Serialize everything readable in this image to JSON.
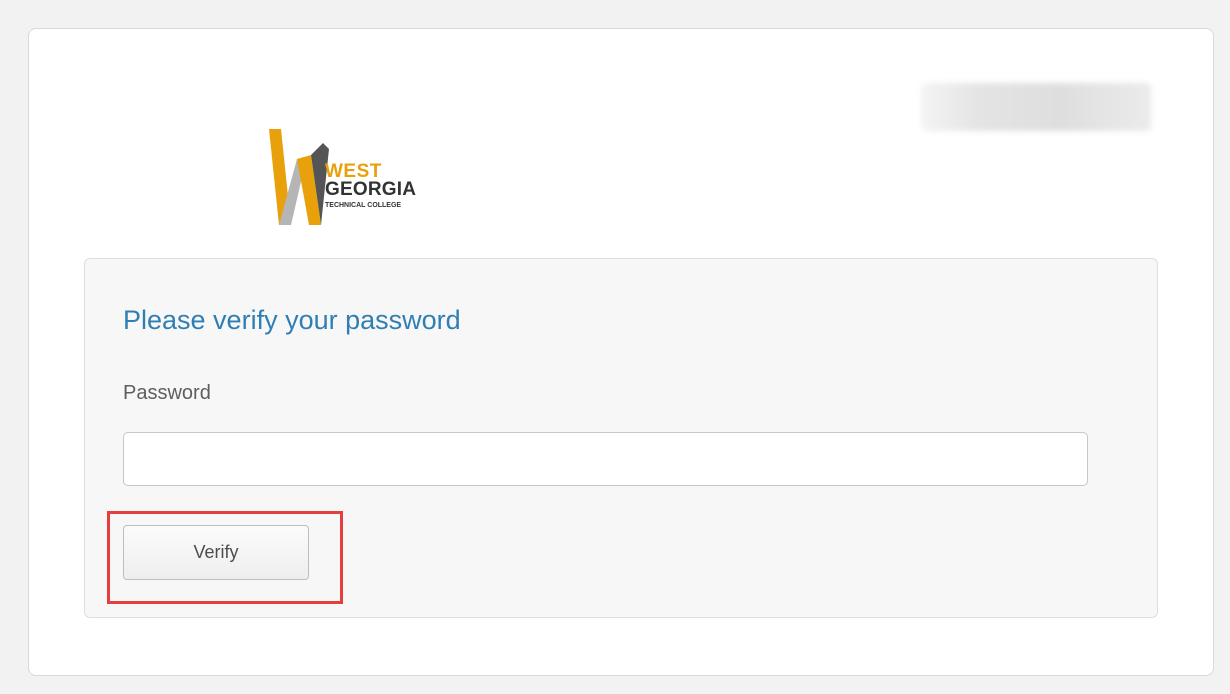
{
  "logo": {
    "line1": "WEST",
    "line2": "GEORGIA",
    "line3": "TECHNICAL COLLEGE",
    "accent_color": "#e8a10b",
    "dark_color": "#333333"
  },
  "form": {
    "title": "Please verify your password",
    "password_label": "Password",
    "password_value": "",
    "verify_label": "Verify",
    "title_color": "#2f7fb5",
    "highlight_color": "#e53e3e"
  }
}
